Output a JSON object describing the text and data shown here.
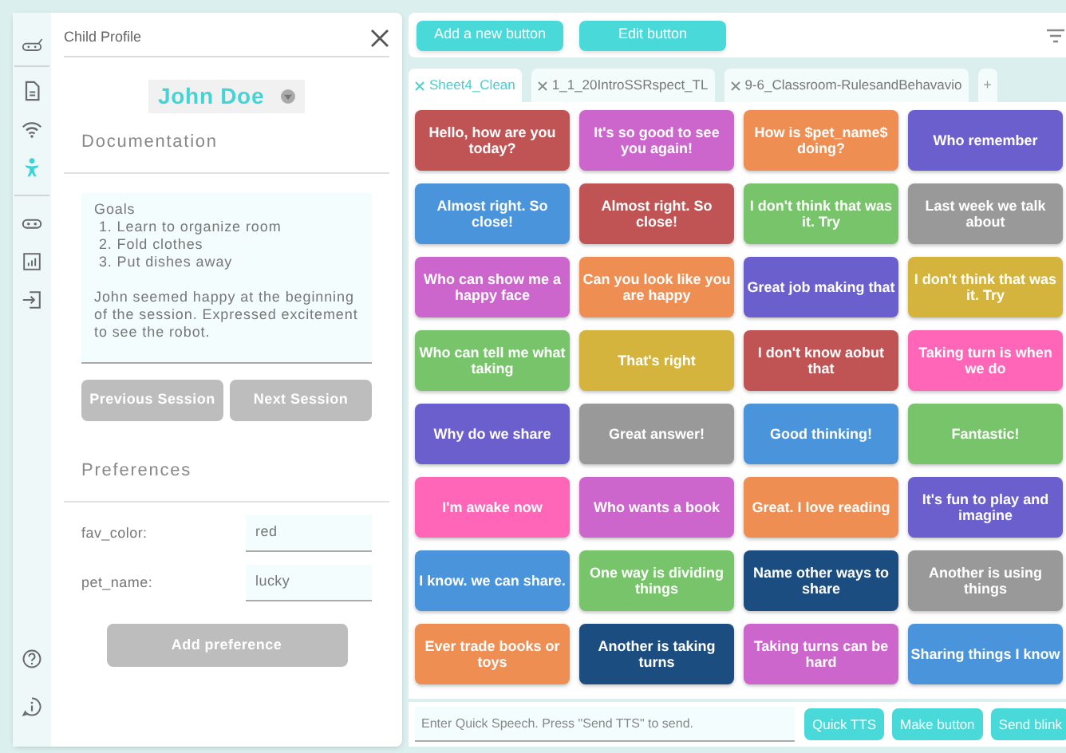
{
  "rail": {
    "items": [
      {
        "kind": "robot",
        "selected": false
      },
      {
        "kind": "document",
        "selected": false
      },
      {
        "kind": "wifi",
        "selected": false
      },
      {
        "kind": "person",
        "selected": true
      },
      {
        "kind": "divider"
      },
      {
        "kind": "controller",
        "selected": false
      },
      {
        "kind": "chart",
        "selected": false
      },
      {
        "kind": "login",
        "selected": false
      }
    ],
    "bottom": [
      {
        "kind": "help"
      },
      {
        "kind": "info"
      }
    ]
  },
  "panel": {
    "title": "Child Profile",
    "child_name": "John Doe",
    "documentation_heading": "Documentation",
    "documentation_text": "Goals\n 1. Learn to organize room\n 2. Fold clothes\n 3. Put dishes away\n\nJohn seemed happy at the beginning of the session. Expressed excitement to see the robot.",
    "session_buttons": [
      {
        "label": "Previous Session",
        "disabled": true
      },
      {
        "label": "Next Session",
        "disabled": true
      }
    ],
    "preferences_heading": "Preferences",
    "preferences": [
      {
        "label": "fav_color:",
        "value": "red"
      },
      {
        "label": "pet_name:",
        "value": "lucky"
      }
    ],
    "add_preference": {
      "label": "Add preference",
      "disabled": true
    }
  },
  "toolbar": {
    "buttons": [
      "Add a new button",
      "Edit button"
    ]
  },
  "tabs": [
    {
      "label": "Sheet4_Clean",
      "selected": true
    },
    {
      "label": "1_1_20IntroSSRspect_TL",
      "selected": false
    },
    {
      "label": "9-6_Classroom-RulesandBehavavio",
      "selected": false
    }
  ],
  "add_tab": "+",
  "speech_buttons": [
    {
      "label": "Hello, how are you today?",
      "color": "#c05454"
    },
    {
      "label": "It's so good to see you again!",
      "color": "#cc66cc"
    },
    {
      "label": "How is $pet_name$ doing?",
      "color": "#ee8e52"
    },
    {
      "label": "Who remember",
      "color": "#6a5fcc"
    },
    {
      "label": "Almost right. So close!",
      "color": "#4a94dc"
    },
    {
      "label": "Almost right. So close!",
      "color": "#c05454"
    },
    {
      "label": "I don't think that was it. Try",
      "color": "#77c46a"
    },
    {
      "label": "Last week we talk about",
      "color": "#999999"
    },
    {
      "label": "Who can show me a happy face",
      "color": "#cc66cc"
    },
    {
      "label": "Can you look like you are happy",
      "color": "#ee8e52"
    },
    {
      "label": "Great job making that",
      "color": "#6a5fcc"
    },
    {
      "label": "I don't think that was it. Try",
      "color": "#d4b43c"
    },
    {
      "label": "Who can tell me what taking",
      "color": "#77c46a"
    },
    {
      "label": "That's right",
      "color": "#d4b43c"
    },
    {
      "label": "I don't know aobut that",
      "color": "#c05454"
    },
    {
      "label": "Taking turn is when we do",
      "color": "#ff66b8"
    },
    {
      "label": "Why do we share",
      "color": "#6a5fcc"
    },
    {
      "label": "Great answer!",
      "color": "#999999"
    },
    {
      "label": "Good thinking!",
      "color": "#4a94dc"
    },
    {
      "label": "Fantastic!",
      "color": "#77c46a"
    },
    {
      "label": "I'm awake now",
      "color": "#ff66b8"
    },
    {
      "label": "Who wants a book",
      "color": "#cc66cc"
    },
    {
      "label": "Great. I love reading",
      "color": "#ee8e52"
    },
    {
      "label": "It's fun to play and imagine",
      "color": "#6a5fcc"
    },
    {
      "label": "I know. we can share.",
      "color": "#4a94dc"
    },
    {
      "label": "One way is dividing things",
      "color": "#77c46a"
    },
    {
      "label": "Name other ways to share",
      "color": "#1b4d80"
    },
    {
      "label": "Another is using things",
      "color": "#999999"
    },
    {
      "label": "Ever trade books or toys",
      "color": "#ee8e52"
    },
    {
      "label": "Another is taking turns",
      "color": "#1b4d80"
    },
    {
      "label": "Taking turns can be hard",
      "color": "#cc66cc"
    },
    {
      "label": "Sharing things I know",
      "color": "#4a94dc"
    }
  ],
  "quick_speech": {
    "placeholder": "Enter Quick Speech. Press \"Send TTS\" to send.",
    "buttons": [
      "Quick TTS",
      "Make button",
      "Send blink"
    ]
  }
}
